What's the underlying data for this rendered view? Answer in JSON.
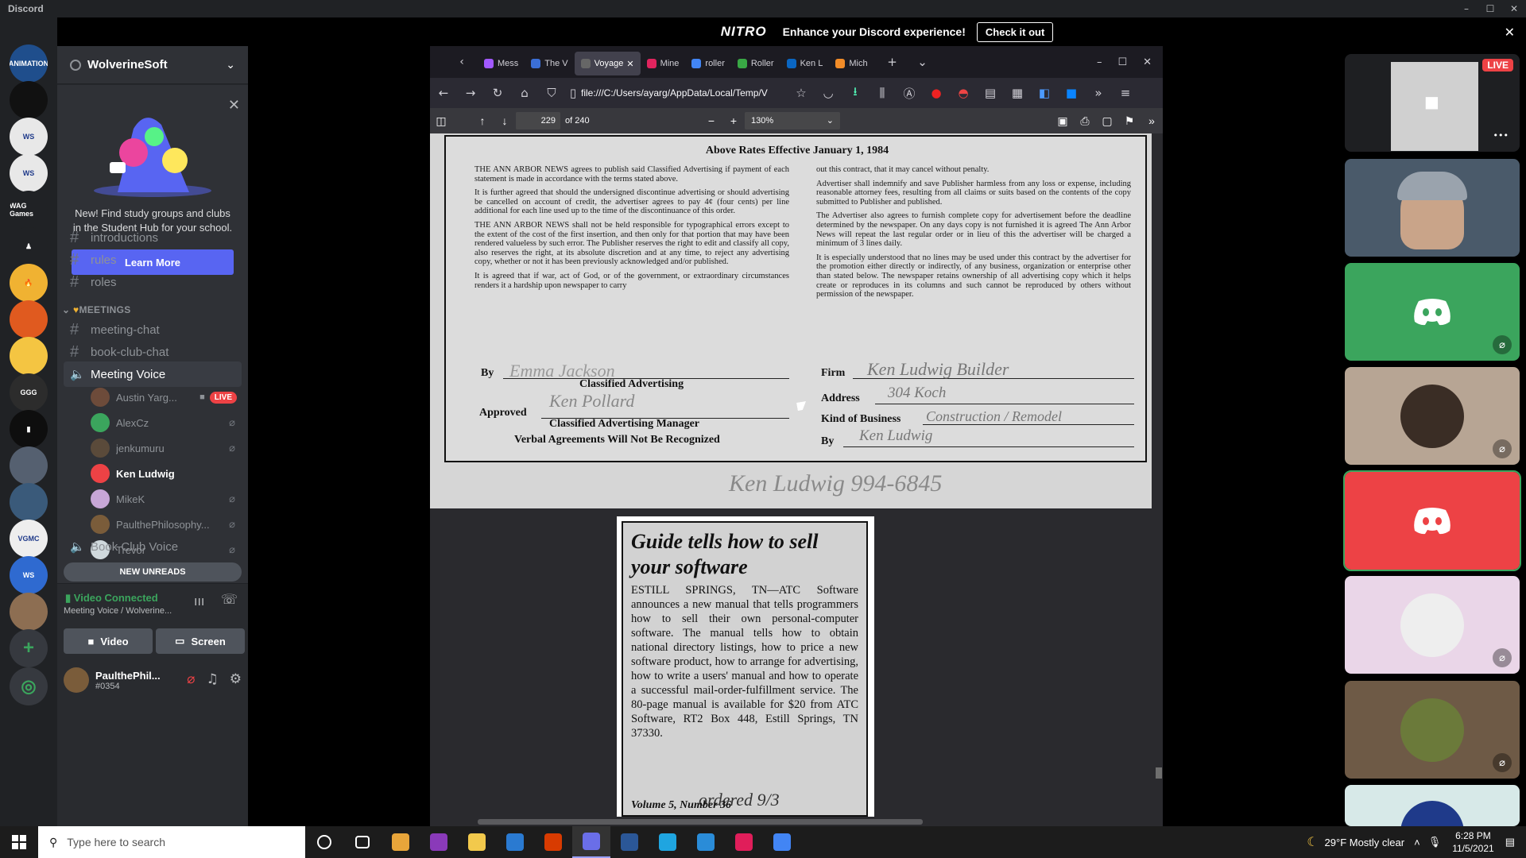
{
  "window": {
    "app_title": "Discord",
    "minimize": "–",
    "maximize": "☐",
    "close": "✕"
  },
  "nitro": {
    "logo": "NITRO",
    "message": "Enhance your Discord experience!",
    "cta": "Check it out",
    "close": "✕"
  },
  "servers": [
    {
      "label": "ANIMATION",
      "color": "#1f4e8c"
    },
    {
      "label": "",
      "color": "#111111"
    },
    {
      "label": "WS",
      "color": "#e8e8e8"
    },
    {
      "label": "WS",
      "color": "#e8e8e8"
    },
    {
      "label": "WAG Games",
      "color": "#202225"
    },
    {
      "label": "♟",
      "color": "#202225"
    },
    {
      "label": "🔥",
      "color": "#f0b232"
    },
    {
      "label": "",
      "color": "#e05a1f"
    },
    {
      "label": "",
      "color": "#f4c542"
    },
    {
      "label": "GGG",
      "color": "#2c2c2c"
    },
    {
      "label": "▮",
      "color": "#0e0e0e"
    },
    {
      "label": "",
      "color": "#556070"
    },
    {
      "label": "",
      "color": "#3a5a7a"
    },
    {
      "label": "VGMC",
      "color": "#eeeeee"
    },
    {
      "label": "WS",
      "color": "#2f6ad0"
    },
    {
      "label": "",
      "color": "#8d6e52"
    }
  ],
  "server_add": "+",
  "server_explore": "◎",
  "sidebar": {
    "server_name": "WolverineSoft",
    "hub": {
      "text": "New! Find study groups and clubs in the Student Hub for your school.",
      "button": "Learn More",
      "close": "✕"
    },
    "channels_top": [
      "introductions",
      "rules",
      "roles"
    ],
    "category_meetings": "MEETINGS",
    "channels_meetings": [
      "meeting-chat",
      "book-club-chat"
    ],
    "voice_channel": "Meeting Voice",
    "voice_users": [
      {
        "name": "Austin Yarg...",
        "live": "LIVE",
        "color": "#6d4b3a"
      },
      {
        "name": "AlexCz",
        "color": "#3ba55d"
      },
      {
        "name": "jenkumuru",
        "color": "#5a4a3a"
      },
      {
        "name": "Ken Ludwig",
        "color": "#ed4245"
      },
      {
        "name": "MikeK",
        "color": "#c7a6d6"
      },
      {
        "name": "PaulthePhilosophy...",
        "color": "#7a5c3a"
      },
      {
        "name": "Trevor",
        "color": "#cfd8dc"
      }
    ],
    "voice_channel_2": "Book Club Voice",
    "new_unreads": "NEW UNREADS",
    "voice_status": "Video Connected",
    "voice_location": "Meeting Voice / Wolverine...",
    "video_btn": "Video",
    "screen_btn": "Screen",
    "user": {
      "name": "PaulthePhil...",
      "tag": "#0354"
    }
  },
  "browser": {
    "tabs": [
      {
        "label": "Mess",
        "color": "#a259ff"
      },
      {
        "label": "The V",
        "color": "#3b6fd6"
      },
      {
        "label": "Voyage",
        "color": "#666666",
        "active": true
      },
      {
        "label": "Mine",
        "color": "#e0245e"
      },
      {
        "label": "roller",
        "color": "#4285f4"
      },
      {
        "label": "Roller",
        "color": "#39a845"
      },
      {
        "label": "Ken L",
        "color": "#0a66c2"
      },
      {
        "label": "Mich",
        "color": "#f28c28"
      }
    ],
    "url": "file:///C:/Users/ayarg/AppData/Local/Temp/V",
    "pdf": {
      "page": "229",
      "of": "of 240",
      "zoom": "130%"
    }
  },
  "document": {
    "heading": "Above Rates Effective January 1, 1984",
    "left_col": [
      "THE ANN ARBOR NEWS agrees to publish said Classified Advertising if payment of each statement is made in accordance with the terms stated above.",
      "It is further agreed that should the undersigned discontinue advertising or should advertising be cancelled on account of credit, the advertiser agrees to pay 4¢ (four cents) per line additional for each line used up to the time of the discontinuance of this order.",
      "THE ANN ARBOR NEWS shall not be held responsible for typographical errors except to the extent of the cost of the first insertion, and then only for that portion that may have been rendered valueless by such error. The Publisher reserves the right to edit and classify all copy, also reserves the right, at its absolute discretion and at any time, to reject any advertising copy, whether or not it has been previously acknowledged and/or published.",
      "It is agreed that if war, act of God, or of the government, or extraordinary circumstances renders it a hardship upon newspaper to carry"
    ],
    "right_col": [
      "out this contract, that it may cancel without penalty.",
      "Advertiser shall indemnify and save Publisher harmless from any loss or expense, including reasonable attorney fees, resulting from all claims or suits based on the contents of the copy submitted to Publisher and published.",
      "The Advertiser also agrees to furnish complete copy for advertisement before the deadline determined by the newspaper. On any days copy is not furnished it is agreed The Ann Arbor News will repeat the last regular order or in lieu of this the advertiser will be charged a minimum of 3 lines daily.",
      "It is especially understood that no lines may be used under this contract by the advertiser for the promotion either directly or indirectly, of any business, organization or enterprise other than stated below. The newspaper retains ownership of all advertising copy which it helps create or reproduces in its columns and such cannot be reproduced by others without permission of the newspaper."
    ],
    "by": "By",
    "classified": "Classified Advertising",
    "approved": "Approved",
    "manager": "Classified Advertising Manager",
    "verbal": "Verbal Agreements Will Not Be Recognized",
    "firm": "Firm",
    "address": "Address",
    "kind": "Kind of Business",
    "by2": "By",
    "hand_firm": "Ken Ludwig Builder",
    "hand_address": "304 Koch",
    "hand_kind": "Construction / Remodel",
    "hand_by": "Ken Ludwig",
    "hand_sig1": "Emma Jackson",
    "hand_sig2": "Ken Pollard",
    "hand_bottom": "Ken Ludwig 994-6845",
    "clip_title": "Guide tells how to sell your software",
    "clip_body": "ESTILL SPRINGS, TN—ATC Software announces a new manual that tells programmers how to sell their own personal-computer software. The manual tells how to obtain national directory listings, how to price a new software product, how to arrange for advertising, how to write a users' manual and how to operate a successful mail-order-fulfillment service. The 80-page manual is available for $20 from ATC Software, RT2 Box 448, Estill Springs, TN 37330.",
    "clip_footer": "Volume 5, Number 36",
    "clip_note": "ordered 9/3"
  },
  "tiles": [
    {
      "kind": "screen",
      "live": "LIVE",
      "bg": "#1e1f22",
      "more": "•••"
    },
    {
      "kind": "camera",
      "bg": "#4a5a6a"
    },
    {
      "kind": "discord",
      "bg": "#3ba55d"
    },
    {
      "kind": "avatar",
      "bg": "#b7a594",
      "av": "#3a2d25"
    },
    {
      "kind": "discord",
      "bg": "#ed4245"
    },
    {
      "kind": "avatar",
      "bg": "#ead6e8",
      "av": "#eee"
    },
    {
      "kind": "avatar",
      "bg": "#6e5a46",
      "av": "#6b7a3a"
    },
    {
      "kind": "avatar",
      "bg": "#d7e9e8",
      "av": "#1f3a8a"
    }
  ],
  "taskbar": {
    "search_placeholder": "Type here to search",
    "weather": "29°F  Mostly clear",
    "time": "6:28 PM",
    "date": "11/5/2021",
    "apps": [
      "#ffffff",
      "#ffffff",
      "#e8a53a",
      "#8a3ab9",
      "#f2c94c",
      "#2a7ad1",
      "#d83b01",
      "#6a6ee8",
      "#2b5797",
      "#1fa5e0",
      "#2a8cd8",
      "#e01e5a",
      "#4285f4"
    ]
  }
}
